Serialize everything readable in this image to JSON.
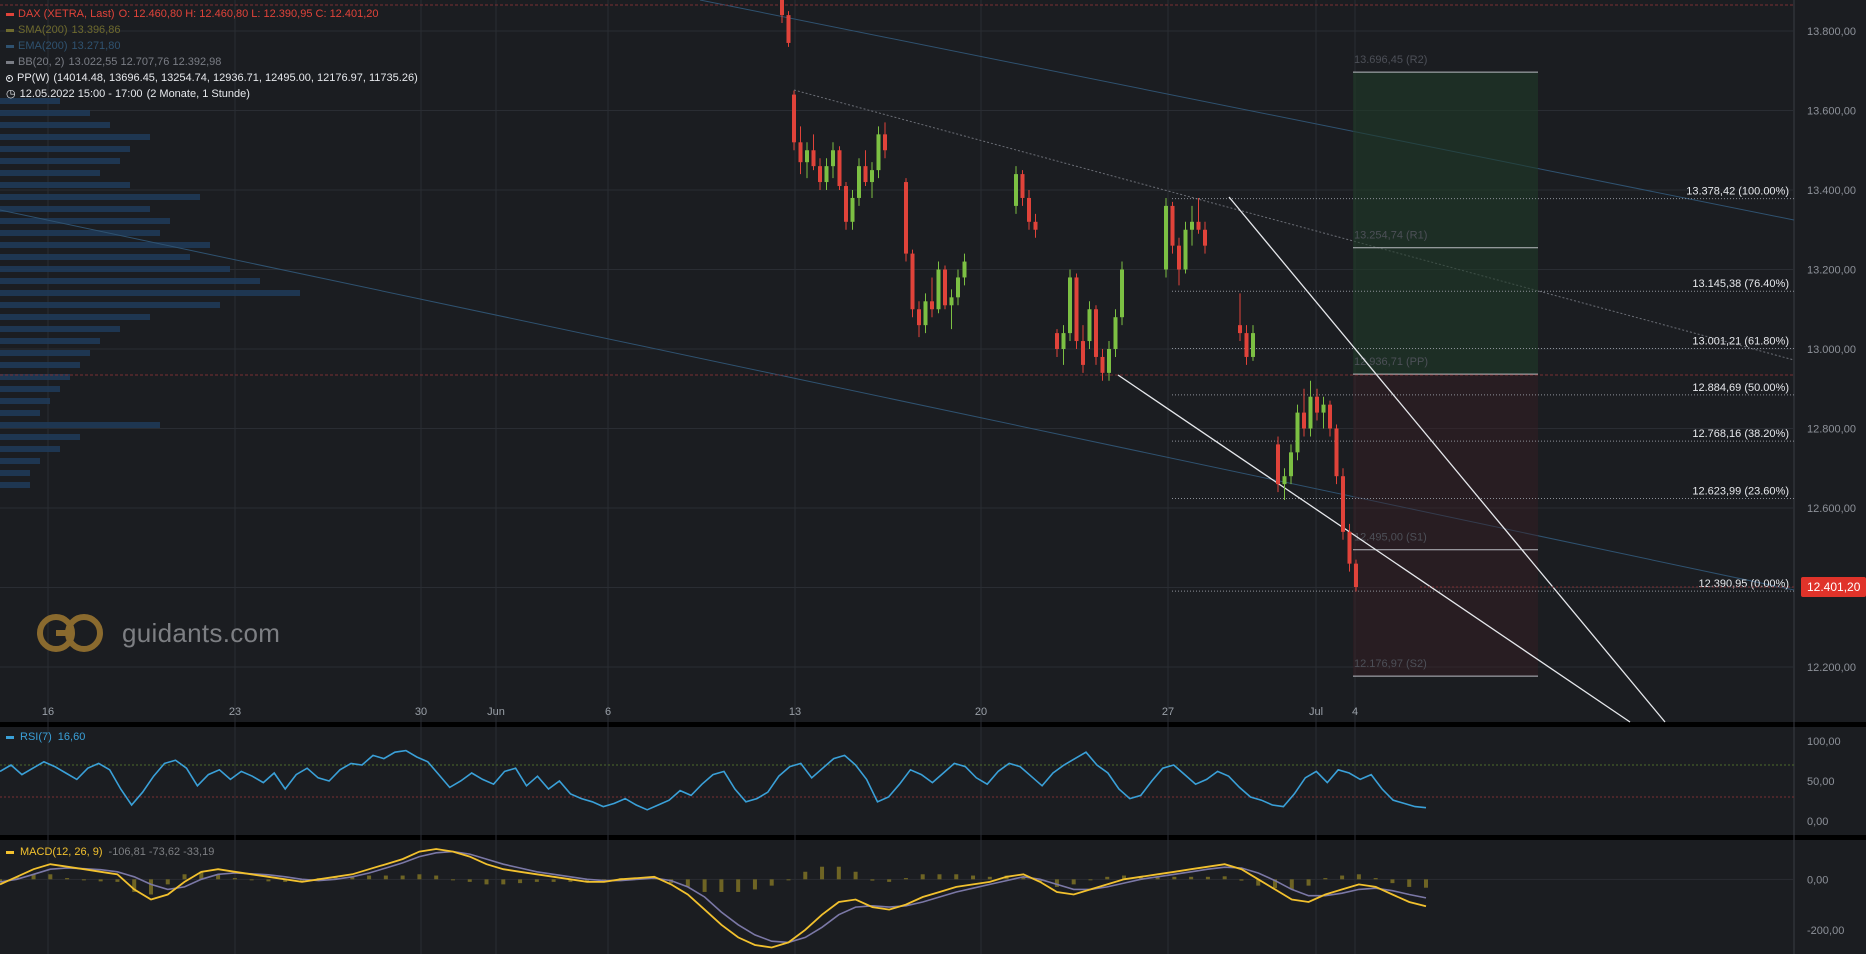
{
  "header": {
    "instrument": "DAX (XETRA, Last)",
    "ohlc": "O: 12.460,80  H: 12.460,80  L: 12.390,95  C: 12.401,20",
    "sma_label": "SMA(200)",
    "sma_value": "13.396,86",
    "ema_label": "EMA(200)",
    "ema_value": "13.271,80",
    "bb_label": "BB(20, 2)",
    "bb_values": "13.022,55  12.707,76  12.392,98",
    "pp_label": "PP(W)",
    "pp_values": "(14014.48, 13696.45, 13254.74, 12936.71, 12495.00, 12176.97, 11735.26)",
    "date_range": "12.05.2022 15:00 - 17:00",
    "timeframe": "(2 Monate, 1 Stunde)"
  },
  "logo": {
    "text": "guidants.com"
  },
  "colors": {
    "background": "#1b1d21",
    "up": "#7cc043",
    "down": "#e0433a",
    "grid": "#2a2d33",
    "rsi": "#3aa0d8",
    "macd": "#f2c12e",
    "signal": "#7b78a6",
    "hist": "#6e6424",
    "last_price_bg": "#e0332a"
  },
  "chart_data": [
    {
      "type": "candlestick",
      "title": "DAX (XETRA, Last)",
      "ylim": [
        12100,
        13880
      ],
      "y_ticks": [
        12200,
        12400,
        12600,
        12800,
        13000,
        13200,
        13400,
        13600,
        13800
      ],
      "y_tick_labels": [
        "12.200,00",
        "",
        "12.600,00",
        "12.800,00",
        "13.000,00",
        "13.200,00",
        "13.400,00",
        "13.600,00",
        "13.800,00"
      ],
      "x_tick_labels": [
        "16",
        "23",
        "30",
        "Jun",
        "6",
        "13",
        "20",
        "27",
        "Jul",
        "4"
      ],
      "last_price": 12401.2,
      "last_price_label": "12.401,20",
      "fib_levels": [
        {
          "value": 13378.42,
          "label": "13.378,42 (100.00%)"
        },
        {
          "value": 13145.38,
          "label": "13.145,38 (76.40%)"
        },
        {
          "value": 13001.21,
          "label": "13.001,21 (61.80%)"
        },
        {
          "value": 12884.69,
          "label": "12.884,69 (50.00%)"
        },
        {
          "value": 12768.16,
          "label": "12.768,16 (38.20%)"
        },
        {
          "value": 12623.99,
          "label": "12.623,99 (23.60%)"
        },
        {
          "value": 12390.95,
          "label": "12.390,95 (0.00%)"
        }
      ],
      "pivot_levels": [
        {
          "value": 13696.45,
          "label": "13.696,45 (R2)"
        },
        {
          "value": 13254.74,
          "label": "13.254,74 (R1)"
        },
        {
          "value": 12936.71,
          "label": "12.936,71 (PP)"
        },
        {
          "value": 12495.0,
          "label": "12.495,00 (S1)"
        },
        {
          "value": 12176.97,
          "label": "12.176,97 (S2)"
        }
      ],
      "series": [
        {
          "name": "DAX",
          "ohlc": [
            [
              13900,
              13920,
              13820,
              13840
            ],
            [
              13840,
              13850,
              13760,
              13770
            ],
            [
              13640,
              13650,
              13500,
              13520
            ],
            [
              13520,
              13560,
              13440,
              13470
            ],
            [
              13470,
              13520,
              13430,
              13500
            ],
            [
              13500,
              13540,
              13450,
              13460
            ],
            [
              13460,
              13480,
              13400,
              13420
            ],
            [
              13420,
              13480,
              13400,
              13460
            ],
            [
              13460,
              13520,
              13430,
              13500
            ],
            [
              13500,
              13510,
              13400,
              13410
            ],
            [
              13410,
              13420,
              13300,
              13320
            ],
            [
              13320,
              13400,
              13300,
              13380
            ],
            [
              13380,
              13480,
              13360,
              13460
            ],
            [
              13460,
              13500,
              13410,
              13420
            ],
            [
              13420,
              13470,
              13380,
              13450
            ],
            [
              13450,
              13560,
              13430,
              13540
            ],
            [
              13540,
              13570,
              13480,
              13500
            ],
            [
              13420,
              13430,
              13220,
              13240
            ],
            [
              13240,
              13250,
              13080,
              13100
            ],
            [
              13100,
              13120,
              13030,
              13060
            ],
            [
              13060,
              13140,
              13040,
              13120
            ],
            [
              13120,
              13180,
              13080,
              13100
            ],
            [
              13100,
              13220,
              13090,
              13200
            ],
            [
              13200,
              13210,
              13100,
              13110
            ],
            [
              13110,
              13150,
              13050,
              13130
            ],
            [
              13130,
              13200,
              13110,
              13180
            ],
            [
              13180,
              13240,
              13160,
              13220
            ],
            [
              13360,
              13460,
              13340,
              13440
            ],
            [
              13440,
              13450,
              13360,
              13380
            ],
            [
              13380,
              13400,
              13300,
              13320
            ],
            [
              13320,
              13340,
              13280,
              13300
            ],
            [
              13040,
              13050,
              12980,
              13000
            ],
            [
              13000,
              13060,
              12960,
              13040
            ],
            [
              13040,
              13200,
              13020,
              13180
            ],
            [
              13180,
              13190,
              13000,
              13020
            ],
            [
              13020,
              13060,
              12940,
              12960
            ],
            [
              13020,
              13120,
              13000,
              13100
            ],
            [
              13100,
              13110,
              12960,
              12980
            ],
            [
              12980,
              13000,
              12920,
              12940
            ],
            [
              12940,
              13020,
              12920,
              13000
            ],
            [
              13000,
              13100,
              12980,
              13080
            ],
            [
              13080,
              13220,
              13060,
              13200
            ],
            [
              13200,
              13380,
              13180,
              13360
            ],
            [
              13360,
              13370,
              13240,
              13260
            ],
            [
              13260,
              13280,
              13160,
              13200
            ],
            [
              13200,
              13320,
              13190,
              13300
            ],
            [
              13300,
              13360,
              13260,
              13320
            ],
            [
              13320,
              13380,
              13290,
              13300
            ],
            [
              13300,
              13320,
              13240,
              13260
            ],
            [
              13060,
              13140,
              13020,
              13040
            ],
            [
              13040,
              13060,
              12960,
              12980
            ],
            [
              12980,
              13060,
              12970,
              13040
            ],
            [
              12760,
              12780,
              12640,
              12660
            ],
            [
              12660,
              12700,
              12620,
              12680
            ],
            [
              12680,
              12760,
              12660,
              12740
            ],
            [
              12740,
              12860,
              12720,
              12840
            ],
            [
              12840,
              12900,
              12780,
              12800
            ],
            [
              12800,
              12920,
              12780,
              12880
            ],
            [
              12880,
              12900,
              12820,
              12840
            ],
            [
              12840,
              12880,
              12800,
              12860
            ],
            [
              12860,
              12870,
              12780,
              12800
            ],
            [
              12800,
              12810,
              12660,
              12680
            ],
            [
              12680,
              12700,
              12520,
              12540
            ],
            [
              12540,
              12560,
              12440,
              12460
            ],
            [
              12460,
              12470,
              12390,
              12401.2
            ]
          ]
        }
      ]
    },
    {
      "type": "line",
      "title": "RSI(7)",
      "value_label": "16,60",
      "ylim": [
        0,
        100
      ],
      "y_tick_labels": [
        "100,00",
        "50,00",
        "0,00"
      ],
      "levels": [
        70,
        30
      ],
      "series": [
        {
          "name": "RSI(7)",
          "values": [
            62,
            70,
            58,
            66,
            74,
            68,
            60,
            52,
            66,
            72,
            64,
            40,
            20,
            36,
            56,
            72,
            76,
            66,
            44,
            58,
            64,
            52,
            62,
            56,
            48,
            60,
            40,
            58,
            66,
            54,
            50,
            64,
            72,
            70,
            82,
            78,
            86,
            88,
            80,
            74,
            58,
            42,
            50,
            60,
            52,
            46,
            62,
            66,
            44,
            56,
            40,
            50,
            34,
            28,
            24,
            18,
            22,
            28,
            20,
            14,
            20,
            26,
            38,
            32,
            46,
            58,
            62,
            40,
            24,
            28,
            36,
            56,
            68,
            72,
            54,
            66,
            78,
            82,
            70,
            52,
            24,
            30,
            46,
            64,
            58,
            48,
            60,
            72,
            68,
            54,
            46,
            62,
            72,
            68,
            56,
            44,
            60,
            70,
            78,
            86,
            70,
            60,
            40,
            28,
            32,
            50,
            66,
            70,
            58,
            46,
            52,
            62,
            56,
            42,
            30,
            26,
            20,
            18,
            34,
            54,
            62,
            48,
            64,
            60,
            52,
            58,
            40,
            26,
            22,
            18,
            16.6
          ]
        }
      ]
    },
    {
      "type": "line",
      "title": "MACD(12, 26, 9)",
      "values_label": "-106,81  -73,62  -33,19",
      "ylim": [
        -280,
        140
      ],
      "y_tick_labels": [
        "0,00",
        "-200,00"
      ],
      "series": [
        {
          "name": "MACD",
          "values": [
            -20,
            10,
            40,
            60,
            50,
            40,
            30,
            20,
            -40,
            -80,
            -60,
            -10,
            30,
            40,
            30,
            20,
            10,
            0,
            -10,
            0,
            10,
            20,
            40,
            60,
            80,
            110,
            120,
            110,
            90,
            60,
            40,
            30,
            20,
            10,
            0,
            -10,
            -10,
            0,
            5,
            10,
            -20,
            -60,
            -120,
            -180,
            -230,
            -260,
            -270,
            -250,
            -200,
            -140,
            -90,
            -80,
            -110,
            -120,
            -100,
            -70,
            -50,
            -30,
            -20,
            -10,
            10,
            20,
            -10,
            -50,
            -60,
            -40,
            -20,
            0,
            10,
            20,
            30,
            40,
            50,
            60,
            40,
            0,
            -40,
            -80,
            -90,
            -60,
            -40,
            -20,
            -30,
            -60,
            -90,
            -106.81
          ]
        },
        {
          "name": "Signal",
          "values": [
            -10,
            0,
            20,
            40,
            45,
            42,
            38,
            30,
            10,
            -20,
            -40,
            -30,
            0,
            20,
            25,
            22,
            18,
            10,
            0,
            -5,
            0,
            10,
            25,
            45,
            65,
            90,
            105,
            110,
            100,
            80,
            60,
            45,
            30,
            20,
            10,
            0,
            -5,
            -5,
            0,
            5,
            -5,
            -30,
            -70,
            -130,
            -180,
            -220,
            -245,
            -250,
            -230,
            -190,
            -140,
            -110,
            -105,
            -110,
            -105,
            -90,
            -70,
            -50,
            -35,
            -20,
            -5,
            10,
            0,
            -20,
            -40,
            -40,
            -30,
            -15,
            0,
            10,
            20,
            30,
            40,
            48,
            45,
            25,
            -5,
            -40,
            -65,
            -65,
            -55,
            -40,
            -35,
            -45,
            -60,
            -73.62
          ]
        },
        {
          "name": "Histogram",
          "values": [
            -10,
            10,
            20,
            20,
            5,
            -2,
            -8,
            -10,
            -50,
            -60,
            -20,
            20,
            30,
            20,
            5,
            -2,
            -8,
            -10,
            -10,
            5,
            10,
            10,
            15,
            15,
            15,
            20,
            15,
            0,
            -10,
            -20,
            -20,
            -15,
            -10,
            -10,
            -10,
            -10,
            -5,
            5,
            5,
            5,
            -15,
            -30,
            -50,
            -50,
            -50,
            -40,
            -25,
            0,
            30,
            50,
            50,
            30,
            -5,
            -10,
            5,
            20,
            20,
            20,
            15,
            10,
            15,
            10,
            -10,
            -30,
            -20,
            0,
            10,
            15,
            10,
            10,
            10,
            10,
            10,
            12,
            -5,
            -25,
            -35,
            -40,
            -25,
            5,
            15,
            20,
            5,
            -15,
            -30,
            -33.19
          ]
        }
      ]
    }
  ]
}
